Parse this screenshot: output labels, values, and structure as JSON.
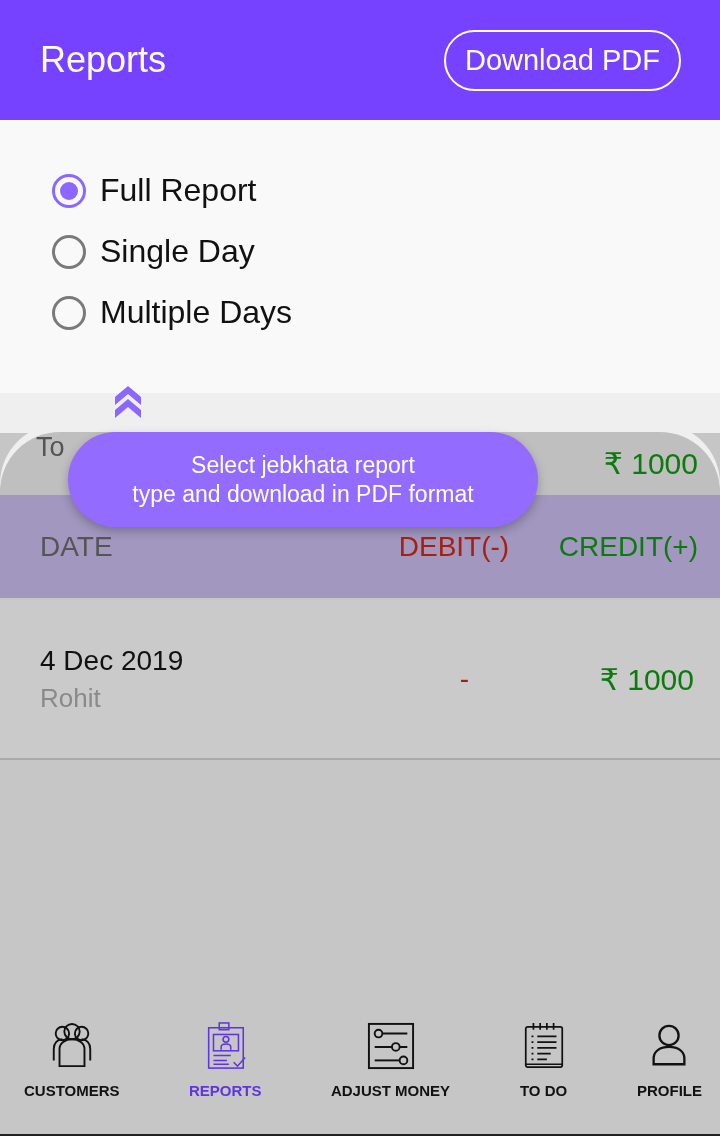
{
  "header": {
    "title": "Reports",
    "download_button": "Download PDF"
  },
  "report_types": [
    {
      "label": "Full Report",
      "selected": true
    },
    {
      "label": "Single Day",
      "selected": false
    },
    {
      "label": "Multiple Days",
      "selected": false
    }
  ],
  "total": {
    "label": "To",
    "amount": "₹ 1000"
  },
  "table": {
    "columns": [
      "DATE",
      "DEBIT(-)",
      "CREDIT(+)"
    ],
    "rows": [
      {
        "date": "4 Dec 2019",
        "name": "Rohit",
        "debit": "-",
        "credit": "₹ 1000"
      }
    ]
  },
  "tooltip": {
    "lines": [
      "Select jebkhata report",
      "type and download in PDF format"
    ]
  },
  "nav": [
    {
      "label": "CUSTOMERS",
      "kind": "customers",
      "selected": false
    },
    {
      "label": "REPORTS",
      "kind": "reports",
      "selected": true
    },
    {
      "label": "ADJUST MONEY",
      "kind": "adjust",
      "selected": false
    },
    {
      "label": "TO DO",
      "kind": "todo",
      "selected": false
    },
    {
      "label": "PROFILE",
      "kind": "profile",
      "selected": false
    }
  ]
}
